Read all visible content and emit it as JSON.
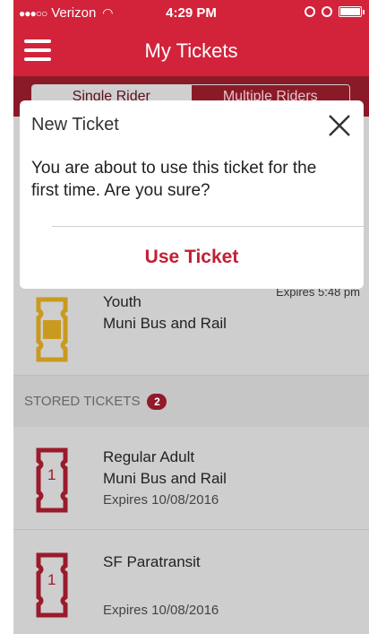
{
  "status": {
    "carrier": "Verizon",
    "time": "4:29 PM"
  },
  "header": {
    "title": "My Tickets"
  },
  "segments": {
    "single": "Single Rider",
    "multiple": "Multiple Riders"
  },
  "active_tickets": [
    {
      "rider": "Youth",
      "service": "Muni Bus and Rail",
      "expires": "Expires 5:48 pm",
      "icon_label": "Muni"
    }
  ],
  "stored": {
    "label": "STORED TICKETS",
    "count": "2",
    "tickets": [
      {
        "rider": "Regular Adult",
        "service": "Muni Bus and Rail",
        "expires": "Expires 10/08/2016",
        "icon_label": "1"
      },
      {
        "rider": "SF Paratransit",
        "expires": "Expires 10/08/2016",
        "icon_label": "1"
      }
    ]
  },
  "modal": {
    "title": "New Ticket",
    "message": "You are about to use this ticket for the first time. Are you sure?",
    "action": "Use Ticket"
  },
  "colors": {
    "brand_red": "#d2233b",
    "action_red": "#c21f34",
    "youth_gold": "#c99a1e",
    "stored_red": "#9a1b2c"
  }
}
